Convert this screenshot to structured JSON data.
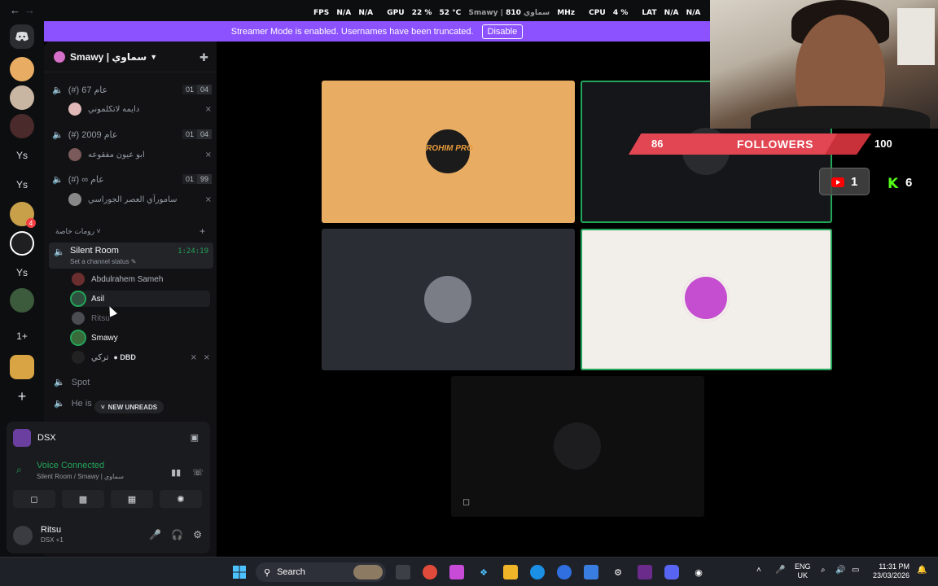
{
  "overlay": {
    "fps_label": "FPS",
    "fps_value": "N/A",
    "fps_value2": "N/A",
    "gpu_label": "GPU",
    "gpu_pct": "22 %",
    "gpu_temp": "52 °C",
    "gpu_mhz": "810 MHz",
    "cpu_label": "CPU",
    "cpu_pct": "4 %",
    "lat_label": "LAT",
    "lat_value": "N/A",
    "lat_value2": "N/A",
    "window_title": "Smawy | سماوي"
  },
  "streamer_banner": {
    "text": "Streamer Mode is enabled. Usernames have been truncated.",
    "button": "Disable"
  },
  "rail": {
    "items": [
      {
        "name": "discord-home-icon",
        "label": ""
      },
      {
        "name": "server-rohimpro",
        "label": ""
      },
      {
        "name": "server-2",
        "label": ""
      },
      {
        "name": "server-3",
        "label": ""
      },
      {
        "name": "server-ys-1",
        "label": "Ys"
      },
      {
        "name": "server-ys-2",
        "label": "Ys"
      },
      {
        "name": "server-4",
        "label": "",
        "badge": "4"
      },
      {
        "name": "server-smawy",
        "label": ""
      },
      {
        "name": "server-ys-3",
        "label": "Ys"
      },
      {
        "name": "server-5",
        "label": ""
      },
      {
        "name": "server-1plus",
        "label": "1+"
      },
      {
        "name": "server-6",
        "label": ""
      },
      {
        "name": "add-server-icon",
        "label": "+"
      }
    ]
  },
  "sidebar": {
    "server_name": "Smawy | سماوي",
    "voice_channels": [
      {
        "name": "(#) 67 عام",
        "limit_a": "01",
        "limit_b": "04",
        "member": "دايمه لاتكلموني"
      },
      {
        "name": "(#) 2009 عام",
        "limit_a": "01",
        "limit_b": "04",
        "member": "ابو عيون مفقوعه"
      },
      {
        "name": "(#) ∞ عام",
        "limit_a": "01",
        "limit_b": "99",
        "member": "سامورآي العصر الجوراسي"
      }
    ],
    "category": "رومات خاصة",
    "silent_room": {
      "name": "Silent Room",
      "status": "Set a channel status",
      "timer": "1:24:19",
      "members": [
        {
          "name": "Abdulrahem Sameh"
        },
        {
          "name": "Asil"
        },
        {
          "name": "Ritsu"
        },
        {
          "name": "Smawy"
        },
        {
          "name": "تركي",
          "activity": "DBD"
        }
      ]
    },
    "spot": "Spot",
    "he_is": "He is",
    "new_unreads": "NEW UNREADS"
  },
  "panel": {
    "stream_name": "DSX",
    "voice_connected": "Voice Connected",
    "voice_channel": "Silent Room / Smawy | سماوي",
    "username": "Ritsu",
    "user_tag": "DSX +1"
  },
  "stage": {
    "tiles": [
      {
        "name": "tile-rohimpro",
        "label": "ROHIM PRO",
        "bg": "#e8ad63"
      },
      {
        "name": "tile-dark-1",
        "label": "",
        "bg": "#14161a"
      },
      {
        "name": "tile-asil",
        "label": "",
        "bg": "#2b2d35"
      },
      {
        "name": "tile-pink-avatar",
        "label": "",
        "bg": "#f2eee9"
      },
      {
        "name": "tile-dark-2",
        "label": "",
        "bg": "#0f0f10"
      }
    ]
  },
  "followers": {
    "current": "86",
    "label": "FOLLOWERS",
    "goal": "100",
    "progress_fraction": 0.86
  },
  "socials": {
    "youtube_count": "1",
    "kick_count": "6"
  },
  "taskbar": {
    "search_label": "Search",
    "lang": "ENG",
    "region": "UK",
    "time": "11:31 PM",
    "date": "23/03/2026"
  },
  "colors": {
    "accent_streamer": "#8c52ff",
    "speaking": "#23a55a",
    "followers_red": "#c8303a"
  }
}
